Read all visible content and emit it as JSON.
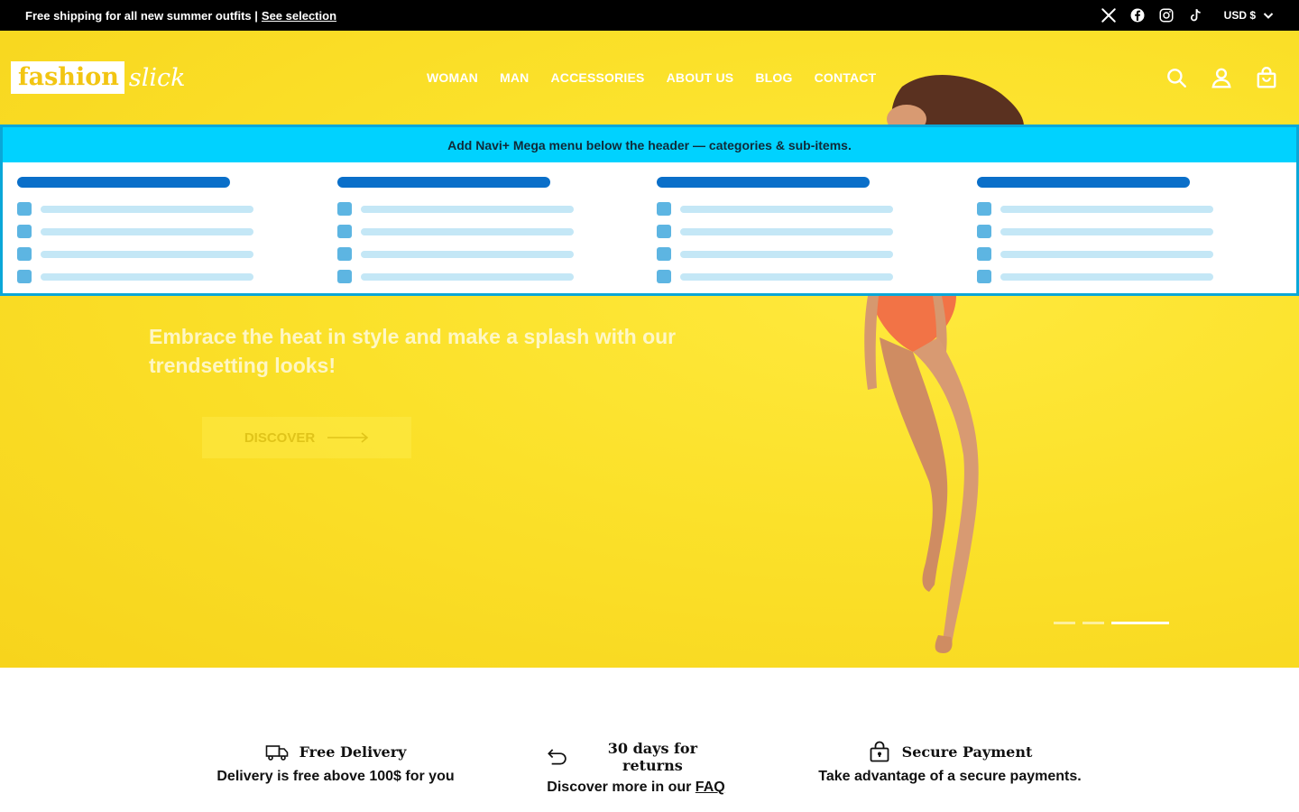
{
  "announcement": {
    "text": "Free shipping for all new summer outfits |",
    "link": "See selection",
    "social_icons": [
      "x-icon",
      "facebook-icon",
      "instagram-icon",
      "tiktok-icon"
    ],
    "currency": "USD $"
  },
  "header": {
    "logo_left": "fashion",
    "logo_right": "slick",
    "nav": [
      "WOMAN",
      "MAN",
      "ACCESSORIES",
      "ABOUT US",
      "BLOG",
      "CONTACT"
    ],
    "icons": [
      "search-icon",
      "account-icon",
      "cart-icon"
    ]
  },
  "mega_menu": {
    "notice": "Add Navi+ Mega menu below the header — categories & sub-items.",
    "columns": 4,
    "rows_per_column": 4
  },
  "hero": {
    "tagline": "Embrace the heat in style and make a splash with our trendsetting looks!",
    "cta": "DISCOVER",
    "slides": 3,
    "active_slide": 3
  },
  "features": [
    {
      "icon": "truck-icon",
      "title": "Free Delivery",
      "desc": "Delivery is free above 100$ for you",
      "link": ""
    },
    {
      "icon": "return-icon",
      "title": "30 days for returns",
      "desc": "Discover more in our ",
      "link": "FAQ"
    },
    {
      "icon": "lock-icon",
      "title": "Secure Payment",
      "desc": "Take advantage of a secure payments.",
      "link": ""
    }
  ],
  "colors": {
    "hero_yellow": "#fbe12a",
    "mega_strip": "#00d2ff",
    "mega_head": "#0a6fc9",
    "topbar": "#000000"
  }
}
